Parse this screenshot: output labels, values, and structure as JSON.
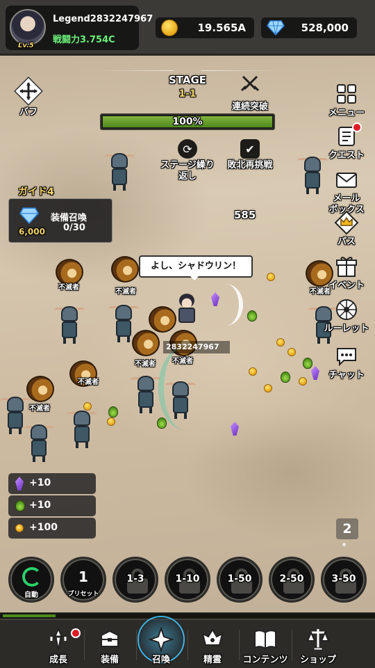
{
  "player": {
    "name": "Legend2832247967",
    "level": "Lv.5",
    "power": "戦闘力3.754C"
  },
  "currency": {
    "gold": "19.565A",
    "gems": "528,000"
  },
  "buff": {
    "label": "バフ"
  },
  "stage": {
    "title": "STAGE",
    "number": "1-1",
    "consecutive_label": "連続突破",
    "progress": 1.0,
    "progress_text": "100%"
  },
  "toggles": {
    "repeat_label": "ステージ繰り返し",
    "retry_label": "敗北再挑戦"
  },
  "guide": {
    "title": "ガイド4",
    "name": "装備召喚",
    "progress": "0/30",
    "reward": "6,000"
  },
  "right_menu": [
    {
      "label": "メニュー",
      "icon": "grid-icon",
      "notify": false
    },
    {
      "label": "クエスト",
      "icon": "quest-icon",
      "notify": true
    },
    {
      "label": "メール ボックス",
      "icon": "mail-icon",
      "notify": false
    },
    {
      "label": "パス",
      "icon": "crown-icon",
      "notify": false
    },
    {
      "label": "イベント",
      "icon": "gift-icon",
      "notify": false
    },
    {
      "label": "ルーレット",
      "icon": "roulette-icon",
      "notify": false
    },
    {
      "label": "チャット",
      "icon": "chat-icon",
      "notify": false
    }
  ],
  "battle": {
    "speech": "よし、シャドウリン！",
    "damage": "585",
    "hero_name": "2832247967",
    "lion_label": "不滅者"
  },
  "loot": [
    {
      "icon": "crystal-icon",
      "text": "+10"
    },
    {
      "icon": "potion-icon",
      "text": "+10"
    },
    {
      "icon": "coin-icon",
      "text": "+100"
    }
  ],
  "page_indicator": "2",
  "summon_buttons": {
    "auto_label": "自動",
    "preset_number": "1",
    "preset_label": "プリセット",
    "locked": [
      "1-3",
      "1-10",
      "1-50",
      "2-50",
      "3-50"
    ]
  },
  "xp_progress": 0.14,
  "bottom_nav": [
    {
      "label": "成長",
      "icon": "growth-icon",
      "notify": true,
      "active": false
    },
    {
      "label": "装備",
      "icon": "equipment-icon",
      "notify": false,
      "active": false
    },
    {
      "label": "召喚",
      "icon": "summon-icon",
      "notify": false,
      "active": true
    },
    {
      "label": "精霊",
      "icon": "spirit-icon",
      "notify": false,
      "active": false
    },
    {
      "label": "コンテンツ",
      "icon": "book-icon",
      "notify": false,
      "active": false
    },
    {
      "label": "ショップ",
      "icon": "shop-icon",
      "notify": false,
      "active": false
    }
  ],
  "colors": {
    "accent_gold": "#f4d56a",
    "power_green": "#6cf07b",
    "notify_red": "#e01b24",
    "active_blue": "#3bb4e8"
  }
}
